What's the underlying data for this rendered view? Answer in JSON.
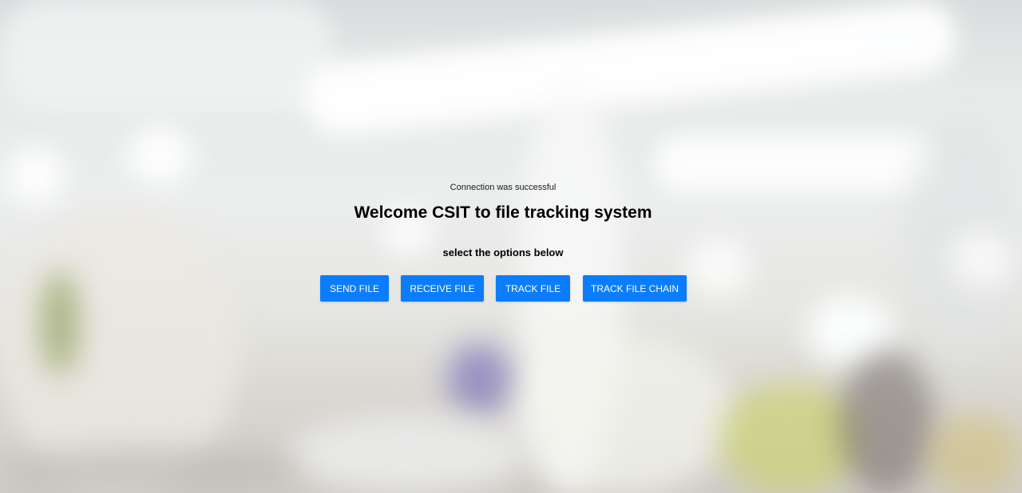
{
  "status": {
    "text": "Connection was successful"
  },
  "header": {
    "title": "Welcome CSIT to file tracking system",
    "subtitle": "select the options below"
  },
  "actions": {
    "send_label": "SEND FILE",
    "receive_label": "RECEIVE FILE",
    "track_label": "TRACK FILE",
    "track_chain_label": "TRACK FILE CHAIN"
  },
  "colors": {
    "button_bg": "#0b7dfb",
    "button_text": "#ffffff",
    "title_text": "#000000"
  }
}
